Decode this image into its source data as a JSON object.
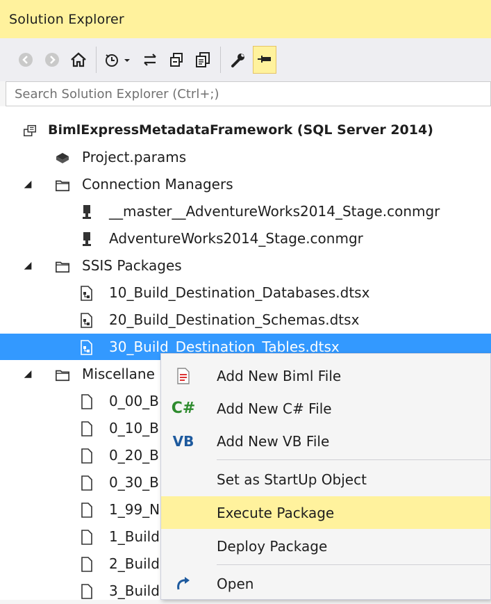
{
  "window": {
    "title": "Solution Explorer"
  },
  "toolbar": {
    "buttons": [
      {
        "icon": "back-icon"
      },
      {
        "icon": "forward-icon"
      },
      {
        "icon": "home-icon"
      },
      {
        "icon": "pending-changes-icon"
      },
      {
        "icon": "sync-icon"
      },
      {
        "icon": "collapse-all-icon"
      },
      {
        "icon": "show-all-files-icon"
      },
      {
        "icon": "properties-wrench-icon"
      },
      {
        "icon": "pin-icon"
      }
    ]
  },
  "search": {
    "placeholder": "Search Solution Explorer (Ctrl+;)"
  },
  "tree": {
    "project": "BimlExpressMetadataFramework (SQL Server 2014)",
    "project_params": "Project.params",
    "connection_managers": {
      "label": "Connection Managers",
      "items": [
        "__master__AdventureWorks2014_Stage.conmgr",
        "AdventureWorks2014_Stage.conmgr"
      ]
    },
    "ssis_packages": {
      "label": "SSIS Packages",
      "items": [
        "10_Build_Destination_Databases.dtsx",
        "20_Build_Destination_Schemas.dtsx",
        "30_Build_Destination_Tables.dtsx"
      ]
    },
    "miscellaneous": {
      "label": "Miscellane",
      "items": [
        "0_00_B",
        "0_10_B",
        "0_20_B",
        "0_30_B",
        "1_99_N",
        "1_Build",
        "2_Build",
        "3_Build"
      ]
    }
  },
  "context_menu": {
    "items": [
      {
        "label": "Add New Biml File",
        "icon": "biml-file-icon"
      },
      {
        "label": "Add New C# File",
        "icon": "csharp-icon",
        "icon_text": "C#"
      },
      {
        "label": "Add New VB File",
        "icon": "vb-icon",
        "icon_text": "VB"
      },
      {
        "label": "Set as StartUp Object"
      },
      {
        "label": "Execute Package",
        "highlighted": true
      },
      {
        "label": "Deploy Package"
      },
      {
        "label": "Open",
        "icon": "open-icon"
      }
    ]
  },
  "colors": {
    "title_bg": "#fff29d",
    "selection": "#3399ff",
    "highlight": "#fff29d",
    "csharp": "#2e8b2e",
    "vb": "#1e5a9e"
  }
}
